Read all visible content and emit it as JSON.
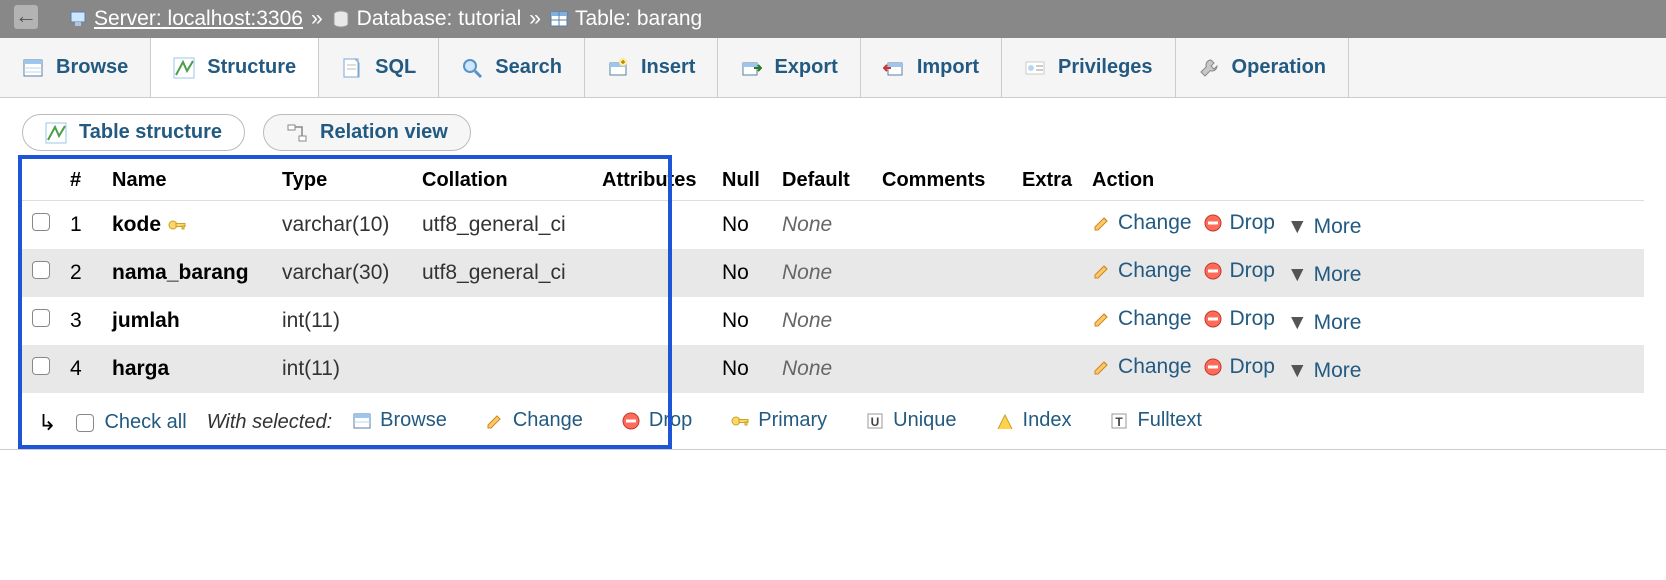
{
  "breadcrumb": {
    "server_label": "Server:",
    "server_value": "localhost:3306",
    "db_label": "Database:",
    "db_value": "tutorial",
    "table_label": "Table:",
    "table_value": "barang"
  },
  "tabs": [
    {
      "label": "Browse",
      "icon": "browse"
    },
    {
      "label": "Structure",
      "icon": "structure",
      "active": true
    },
    {
      "label": "SQL",
      "icon": "sql"
    },
    {
      "label": "Search",
      "icon": "search"
    },
    {
      "label": "Insert",
      "icon": "insert"
    },
    {
      "label": "Export",
      "icon": "export"
    },
    {
      "label": "Import",
      "icon": "import"
    },
    {
      "label": "Privileges",
      "icon": "privileges"
    },
    {
      "label": "Operation",
      "icon": "operations"
    }
  ],
  "subtabs": {
    "table_structure": "Table structure",
    "relation_view": "Relation view"
  },
  "table": {
    "headers": {
      "num": "#",
      "name": "Name",
      "type": "Type",
      "collation": "Collation",
      "attributes": "Attributes",
      "null": "Null",
      "default": "Default",
      "comments": "Comments",
      "extra": "Extra",
      "action": "Action"
    },
    "rows": [
      {
        "num": "1",
        "name": "kode",
        "primary": true,
        "type": "varchar(10)",
        "collation": "utf8_general_ci",
        "attributes": "",
        "null": "No",
        "default": "None",
        "comments": "",
        "extra": ""
      },
      {
        "num": "2",
        "name": "nama_barang",
        "primary": false,
        "type": "varchar(30)",
        "collation": "utf8_general_ci",
        "attributes": "",
        "null": "No",
        "default": "None",
        "comments": "",
        "extra": ""
      },
      {
        "num": "3",
        "name": "jumlah",
        "primary": false,
        "type": "int(11)",
        "collation": "",
        "attributes": "",
        "null": "No",
        "default": "None",
        "comments": "",
        "extra": ""
      },
      {
        "num": "4",
        "name": "harga",
        "primary": false,
        "type": "int(11)",
        "collation": "",
        "attributes": "",
        "null": "No",
        "default": "None",
        "comments": "",
        "extra": ""
      }
    ],
    "actions": {
      "change": "Change",
      "drop": "Drop",
      "more": "More"
    }
  },
  "bottom": {
    "check_all": "Check all",
    "with_selected": "With selected:",
    "actions": [
      {
        "label": "Browse",
        "icon": "browse"
      },
      {
        "label": "Change",
        "icon": "pencil"
      },
      {
        "label": "Drop",
        "icon": "drop"
      },
      {
        "label": "Primary",
        "icon": "key"
      },
      {
        "label": "Unique",
        "icon": "unique"
      },
      {
        "label": "Index",
        "icon": "index"
      },
      {
        "label": "Fulltext",
        "icon": "fulltext"
      }
    ]
  }
}
